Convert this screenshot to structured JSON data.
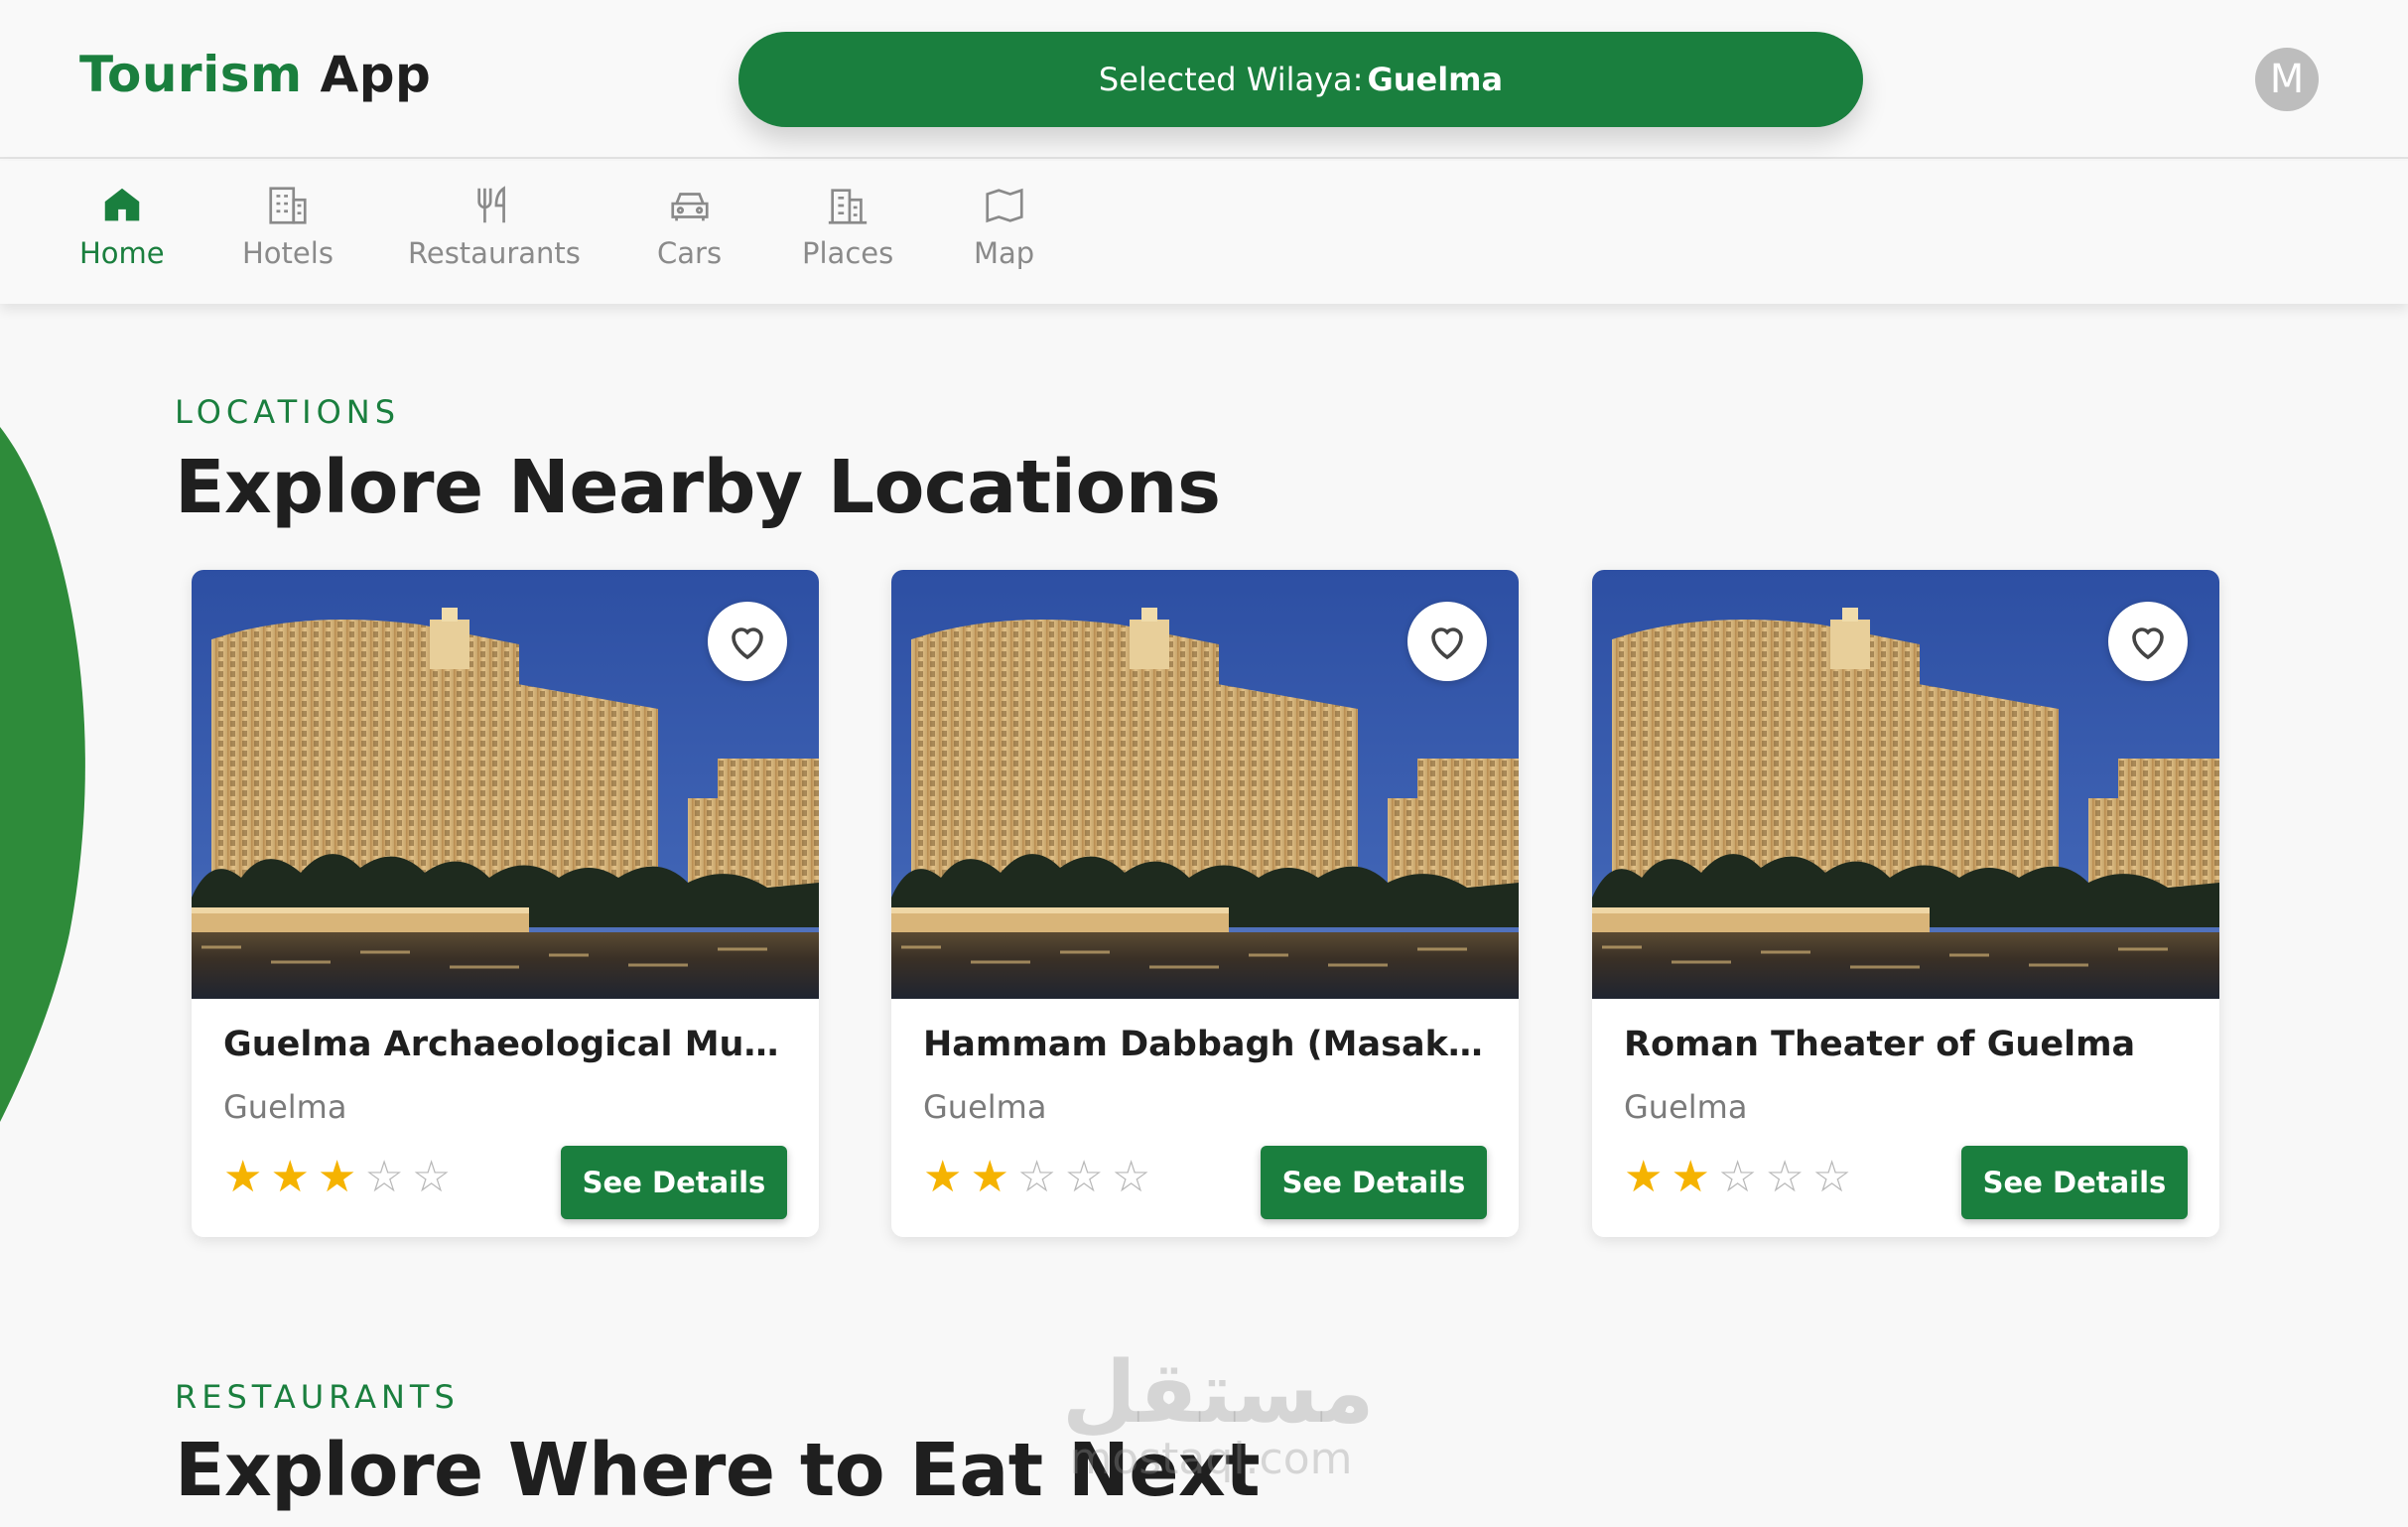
{
  "header": {
    "brand_part1": "Tourism",
    "brand_part2": "App",
    "wilaya_label": "Selected Wilaya:",
    "wilaya_value": "Guelma",
    "avatar_initial": "M"
  },
  "nav": {
    "items": [
      {
        "label": "Home",
        "icon": "home-icon",
        "active": true
      },
      {
        "label": "Hotels",
        "icon": "hotel-icon"
      },
      {
        "label": "Restaurants",
        "icon": "utensils-icon"
      },
      {
        "label": "Cars",
        "icon": "car-icon"
      },
      {
        "label": "Places",
        "icon": "building-icon"
      },
      {
        "label": "Map",
        "icon": "map-icon"
      }
    ]
  },
  "locations": {
    "eyebrow": "LOCATIONS",
    "title": "Explore Nearby Locations",
    "cards": [
      {
        "title": "Guelma Archaeological Muse...",
        "city": "Guelma",
        "rating": 3,
        "max_rating": 5,
        "button": "See Details"
      },
      {
        "title": "Hammam Dabbagh (Masakh...",
        "city": "Guelma",
        "rating": 2,
        "max_rating": 5,
        "button": "See Details"
      },
      {
        "title": "Roman Theater of Guelma",
        "city": "Guelma",
        "rating": 2,
        "max_rating": 5,
        "button": "See Details"
      }
    ]
  },
  "restaurants": {
    "eyebrow": "RESTAURANTS",
    "title": "Explore Where to Eat Next"
  },
  "watermark": {
    "arabic": "مستقل",
    "latin": "mostaql.com"
  },
  "colors": {
    "accent": "#1a7f3e",
    "star": "#f5b301",
    "muted": "#8a8a8a"
  }
}
